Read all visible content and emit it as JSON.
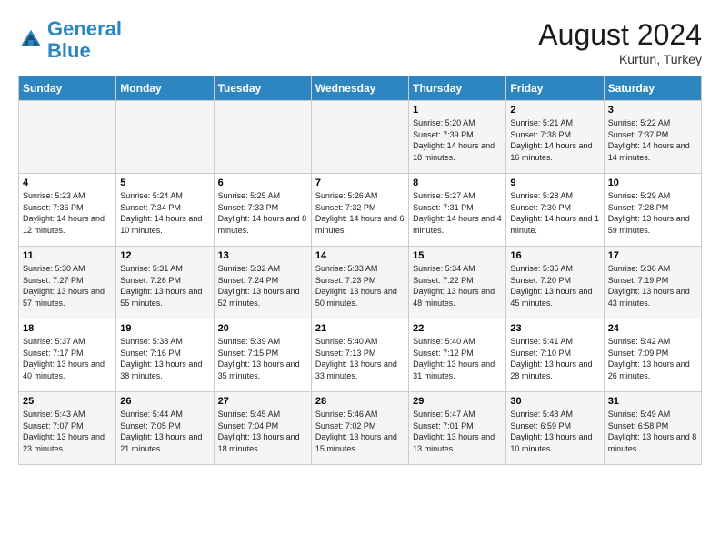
{
  "header": {
    "logo_line1": "General",
    "logo_line2": "Blue",
    "month_year": "August 2024",
    "location": "Kurtun, Turkey"
  },
  "days_of_week": [
    "Sunday",
    "Monday",
    "Tuesday",
    "Wednesday",
    "Thursday",
    "Friday",
    "Saturday"
  ],
  "weeks": [
    [
      {
        "day": "",
        "sunrise": "",
        "sunset": "",
        "daylight": ""
      },
      {
        "day": "",
        "sunrise": "",
        "sunset": "",
        "daylight": ""
      },
      {
        "day": "",
        "sunrise": "",
        "sunset": "",
        "daylight": ""
      },
      {
        "day": "",
        "sunrise": "",
        "sunset": "",
        "daylight": ""
      },
      {
        "day": "1",
        "sunrise": "Sunrise: 5:20 AM",
        "sunset": "Sunset: 7:39 PM",
        "daylight": "Daylight: 14 hours and 18 minutes."
      },
      {
        "day": "2",
        "sunrise": "Sunrise: 5:21 AM",
        "sunset": "Sunset: 7:38 PM",
        "daylight": "Daylight: 14 hours and 16 minutes."
      },
      {
        "day": "3",
        "sunrise": "Sunrise: 5:22 AM",
        "sunset": "Sunset: 7:37 PM",
        "daylight": "Daylight: 14 hours and 14 minutes."
      }
    ],
    [
      {
        "day": "4",
        "sunrise": "Sunrise: 5:23 AM",
        "sunset": "Sunset: 7:36 PM",
        "daylight": "Daylight: 14 hours and 12 minutes."
      },
      {
        "day": "5",
        "sunrise": "Sunrise: 5:24 AM",
        "sunset": "Sunset: 7:34 PM",
        "daylight": "Daylight: 14 hours and 10 minutes."
      },
      {
        "day": "6",
        "sunrise": "Sunrise: 5:25 AM",
        "sunset": "Sunset: 7:33 PM",
        "daylight": "Daylight: 14 hours and 8 minutes."
      },
      {
        "day": "7",
        "sunrise": "Sunrise: 5:26 AM",
        "sunset": "Sunset: 7:32 PM",
        "daylight": "Daylight: 14 hours and 6 minutes."
      },
      {
        "day": "8",
        "sunrise": "Sunrise: 5:27 AM",
        "sunset": "Sunset: 7:31 PM",
        "daylight": "Daylight: 14 hours and 4 minutes."
      },
      {
        "day": "9",
        "sunrise": "Sunrise: 5:28 AM",
        "sunset": "Sunset: 7:30 PM",
        "daylight": "Daylight: 14 hours and 1 minute."
      },
      {
        "day": "10",
        "sunrise": "Sunrise: 5:29 AM",
        "sunset": "Sunset: 7:28 PM",
        "daylight": "Daylight: 13 hours and 59 minutes."
      }
    ],
    [
      {
        "day": "11",
        "sunrise": "Sunrise: 5:30 AM",
        "sunset": "Sunset: 7:27 PM",
        "daylight": "Daylight: 13 hours and 57 minutes."
      },
      {
        "day": "12",
        "sunrise": "Sunrise: 5:31 AM",
        "sunset": "Sunset: 7:26 PM",
        "daylight": "Daylight: 13 hours and 55 minutes."
      },
      {
        "day": "13",
        "sunrise": "Sunrise: 5:32 AM",
        "sunset": "Sunset: 7:24 PM",
        "daylight": "Daylight: 13 hours and 52 minutes."
      },
      {
        "day": "14",
        "sunrise": "Sunrise: 5:33 AM",
        "sunset": "Sunset: 7:23 PM",
        "daylight": "Daylight: 13 hours and 50 minutes."
      },
      {
        "day": "15",
        "sunrise": "Sunrise: 5:34 AM",
        "sunset": "Sunset: 7:22 PM",
        "daylight": "Daylight: 13 hours and 48 minutes."
      },
      {
        "day": "16",
        "sunrise": "Sunrise: 5:35 AM",
        "sunset": "Sunset: 7:20 PM",
        "daylight": "Daylight: 13 hours and 45 minutes."
      },
      {
        "day": "17",
        "sunrise": "Sunrise: 5:36 AM",
        "sunset": "Sunset: 7:19 PM",
        "daylight": "Daylight: 13 hours and 43 minutes."
      }
    ],
    [
      {
        "day": "18",
        "sunrise": "Sunrise: 5:37 AM",
        "sunset": "Sunset: 7:17 PM",
        "daylight": "Daylight: 13 hours and 40 minutes."
      },
      {
        "day": "19",
        "sunrise": "Sunrise: 5:38 AM",
        "sunset": "Sunset: 7:16 PM",
        "daylight": "Daylight: 13 hours and 38 minutes."
      },
      {
        "day": "20",
        "sunrise": "Sunrise: 5:39 AM",
        "sunset": "Sunset: 7:15 PM",
        "daylight": "Daylight: 13 hours and 35 minutes."
      },
      {
        "day": "21",
        "sunrise": "Sunrise: 5:40 AM",
        "sunset": "Sunset: 7:13 PM",
        "daylight": "Daylight: 13 hours and 33 minutes."
      },
      {
        "day": "22",
        "sunrise": "Sunrise: 5:40 AM",
        "sunset": "Sunset: 7:12 PM",
        "daylight": "Daylight: 13 hours and 31 minutes."
      },
      {
        "day": "23",
        "sunrise": "Sunrise: 5:41 AM",
        "sunset": "Sunset: 7:10 PM",
        "daylight": "Daylight: 13 hours and 28 minutes."
      },
      {
        "day": "24",
        "sunrise": "Sunrise: 5:42 AM",
        "sunset": "Sunset: 7:09 PM",
        "daylight": "Daylight: 13 hours and 26 minutes."
      }
    ],
    [
      {
        "day": "25",
        "sunrise": "Sunrise: 5:43 AM",
        "sunset": "Sunset: 7:07 PM",
        "daylight": "Daylight: 13 hours and 23 minutes."
      },
      {
        "day": "26",
        "sunrise": "Sunrise: 5:44 AM",
        "sunset": "Sunset: 7:05 PM",
        "daylight": "Daylight: 13 hours and 21 minutes."
      },
      {
        "day": "27",
        "sunrise": "Sunrise: 5:45 AM",
        "sunset": "Sunset: 7:04 PM",
        "daylight": "Daylight: 13 hours and 18 minutes."
      },
      {
        "day": "28",
        "sunrise": "Sunrise: 5:46 AM",
        "sunset": "Sunset: 7:02 PM",
        "daylight": "Daylight: 13 hours and 15 minutes."
      },
      {
        "day": "29",
        "sunrise": "Sunrise: 5:47 AM",
        "sunset": "Sunset: 7:01 PM",
        "daylight": "Daylight: 13 hours and 13 minutes."
      },
      {
        "day": "30",
        "sunrise": "Sunrise: 5:48 AM",
        "sunset": "Sunset: 6:59 PM",
        "daylight": "Daylight: 13 hours and 10 minutes."
      },
      {
        "day": "31",
        "sunrise": "Sunrise: 5:49 AM",
        "sunset": "Sunset: 6:58 PM",
        "daylight": "Daylight: 13 hours and 8 minutes."
      }
    ]
  ]
}
